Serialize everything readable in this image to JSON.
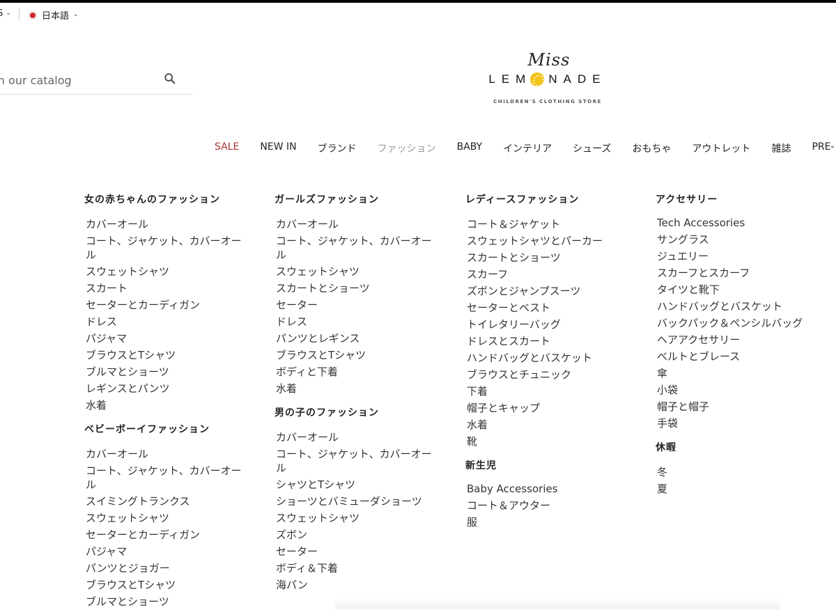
{
  "topbar": {
    "currency_label": "S",
    "language_label": "日本語"
  },
  "search": {
    "placeholder": "ch our catalog"
  },
  "logo": {
    "script": "Miss",
    "main_left": "LEM",
    "main_right": "NADE",
    "tagline": "CHILDREN'S CLOTHING STORE"
  },
  "nav": [
    "SALE",
    "NEW IN",
    "ブランド",
    "ファッション",
    "BABY",
    "インテリア",
    "シューズ",
    "おもちゃ",
    "アウトレット",
    "雑誌",
    "PRE-"
  ],
  "menu": {
    "col1": {
      "sections": [
        {
          "title": "女の赤ちゃんのファッション",
          "items": [
            "カバーオール",
            "コート、ジャケット、カバーオール",
            "スウェットシャツ",
            "スカート",
            "セーターとカーディガン",
            "ドレス",
            "パジャマ",
            "ブラウスとTシャツ",
            "ブルマとショーツ",
            "レギンスとパンツ",
            "水着"
          ]
        },
        {
          "title": "ベビーボーイファッション",
          "items": [
            "カバーオール",
            "コート、ジャケット、カバーオール",
            "スイミングトランクス",
            "スウェットシャツ",
            "セーターとカーディガン",
            "パジャマ",
            "パンツとジョガー",
            "ブラウスとTシャツ",
            "ブルマとショーツ"
          ]
        }
      ]
    },
    "col2": {
      "sections": [
        {
          "title": "ガールズファッション",
          "items": [
            "カバーオール",
            "コート、ジャケット、カバーオール",
            "スウェットシャツ",
            "スカートとショーツ",
            "セーター",
            "ドレス",
            "パンツとレギンス",
            "ブラウスとTシャツ",
            "ボディと下着",
            "水着"
          ]
        },
        {
          "title": "男の子のファッション",
          "items": [
            "カバーオール",
            "コート、ジャケット、カバーオール",
            "シャツとTシャツ",
            "ショーツとバミューダショーツ",
            "スウェットシャツ",
            "ズボン",
            "セーター",
            "ボディ＆下着",
            "海パン"
          ]
        }
      ]
    },
    "col3": {
      "sections": [
        {
          "title": "レディースファッション",
          "items": [
            "コート＆ジャケット",
            "スウェットシャツとパーカー",
            "スカートとショーツ",
            "スカーフ",
            "ズボンとジャンプスーツ",
            "セーターとベスト",
            "トイレタリーバッグ",
            "ドレスとスカート",
            "ハンドバッグとバスケット",
            "ブラウスとチュニック",
            "下着",
            "帽子とキャップ",
            "水着",
            "靴"
          ]
        },
        {
          "title": "新生児",
          "items": [
            "Baby Accessories",
            "コート＆アウター",
            "服"
          ]
        }
      ]
    },
    "col4": {
      "sections": [
        {
          "title": "アクセサリー",
          "items": [
            "Tech Accessories",
            "サングラス",
            "ジュエリー",
            "スカーフとスカーフ",
            "タイツと靴下",
            "ハンドバッグとバスケット",
            "バックパック＆ペンシルバッグ",
            "ヘアアクセサリー",
            "ベルトとブレース",
            "傘",
            "小袋",
            "帽子と帽子",
            "手袋"
          ]
        },
        {
          "title": "休暇",
          "items": [
            "冬",
            "夏"
          ]
        }
      ]
    }
  }
}
